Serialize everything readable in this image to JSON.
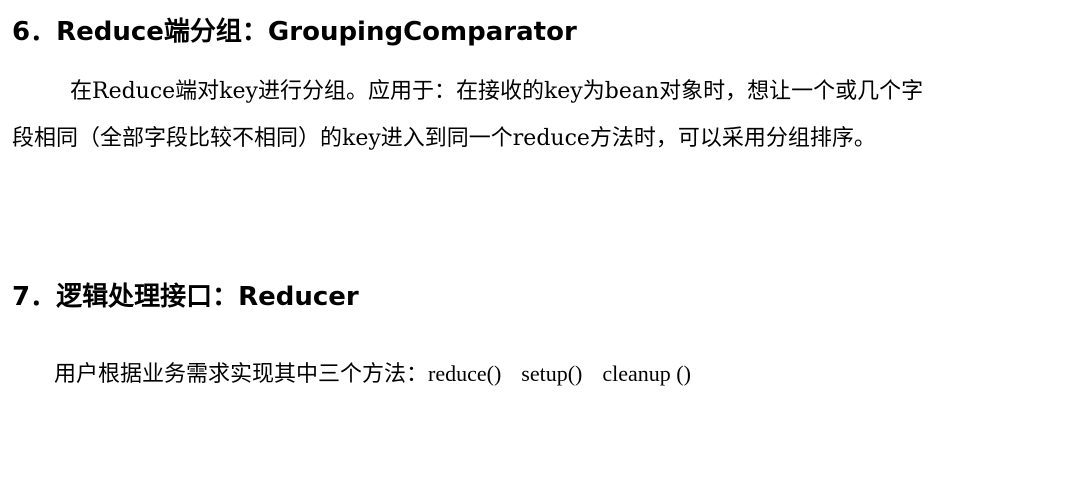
{
  "section6": {
    "heading": "6．Reduce端分组：GroupingComparator",
    "paragraph_line1": "在Reduce端对key进行分组。应用于：在接收的key为bean对象时，想让一个或几个字",
    "paragraph_line2": "段相同（全部字段比较不相同）的key进入到同一个reduce方法时，可以采用分组排序。"
  },
  "section7": {
    "heading": "7．逻辑处理接口：Reducer",
    "intro": "用户根据业务需求实现其中三个方法：",
    "methods": [
      "reduce()",
      "setup()",
      "cleanup ()"
    ]
  }
}
